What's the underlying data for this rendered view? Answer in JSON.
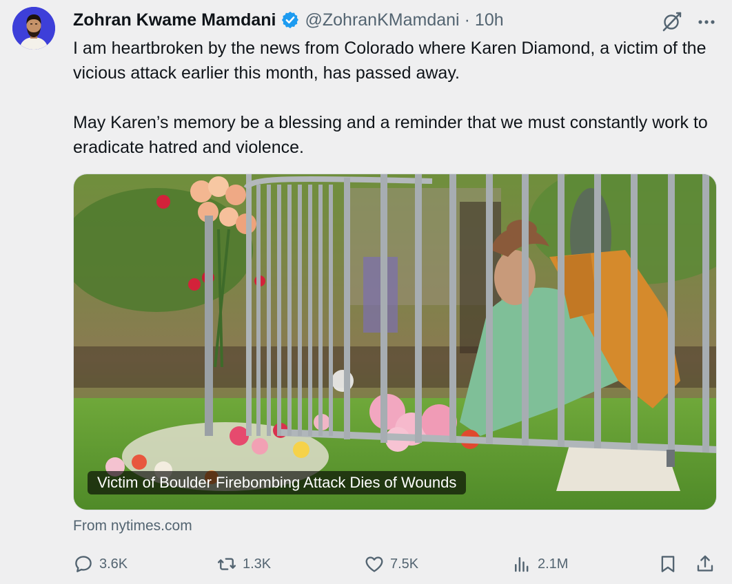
{
  "author": {
    "display_name": "Zohran Kwame Mamdani",
    "handle": "@ZohranKMamdani",
    "separator": "·",
    "time": "10h",
    "verified": true,
    "verified_color": "#1d9bf0",
    "avatar_background": "#3d3fd9"
  },
  "header_icons": {
    "grok": "grok-icon",
    "more": "more-icon"
  },
  "text": {
    "paragraph1": "I am heartbroken by the news from Colorado where Karen Diamond, a victim of the vicious attack earlier this month, has passed away.",
    "paragraph2": "May Karen’s memory be a blessing and a reminder that we must constantly work to eradicate hatred and violence."
  },
  "card": {
    "title": "Victim of Boulder Firebombing Attack Dies of Wounds",
    "source": "From nytimes.com",
    "image": "photo of a woman in a green jacket laying flowers at a metal barricade memorial on grass"
  },
  "actions": {
    "replies": "3.6K",
    "reposts": "1.3K",
    "likes": "7.5K",
    "views": "2.1M"
  },
  "colors": {
    "background": "#efeff0",
    "text": "#0f1419",
    "secondary": "#536471"
  }
}
